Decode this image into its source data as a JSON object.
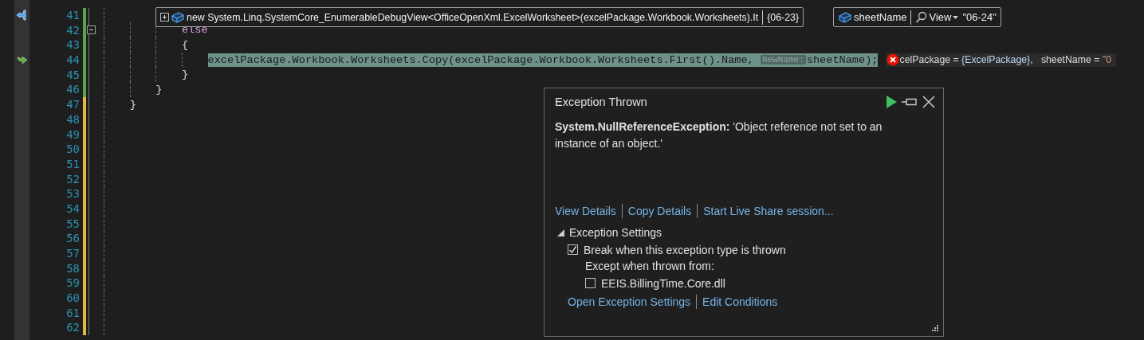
{
  "editor": {
    "lines": [
      {
        "number": "41",
        "color": "#57a64a",
        "marker": {
          "kind": "pin"
        }
      },
      {
        "number": "42",
        "color": "#57a64a",
        "fold": {
          "expanded": true
        },
        "tokens": [
          {
            "text": "            else",
            "kind": "control"
          }
        ]
      },
      {
        "number": "43",
        "color": "#57a64a",
        "tokens": [
          {
            "text": "            {",
            "kind": "plain"
          }
        ]
      },
      {
        "number": "44",
        "color": "#57a64a",
        "marker": {
          "kind": "return"
        },
        "current": true,
        "tokens": [
          {
            "text": "                excelPackage.Workbook.Worksheets.Copy(excelPackage.Workbook.Worksheets.First().Name, ",
            "kind": "plain"
          },
          {
            "text": "NewName:",
            "kind": "hint"
          },
          {
            "text": "sheetName);",
            "kind": "plain"
          }
        ],
        "inline_values": {
          "error": true,
          "parts": [
            {
              "text": "celPackage = ",
              "kind": "plain"
            },
            {
              "text": "{ExcelPackage}",
              "kind": "type"
            },
            {
              "text": ",   sheetName = ",
              "kind": "plain"
            },
            {
              "text": "\"0",
              "kind": "string"
            }
          ]
        }
      },
      {
        "number": "45",
        "color": "#57a64a",
        "tokens": [
          {
            "text": "            }",
            "kind": "plain"
          }
        ]
      },
      {
        "number": "46",
        "color": "#57a64a",
        "tokens": [
          {
            "text": "        }",
            "kind": "plain"
          }
        ]
      },
      {
        "number": "47",
        "color": "#e2b93d",
        "tokens": [
          {
            "text": "    }",
            "kind": "plain"
          }
        ]
      },
      {
        "number": "48",
        "color": "#e2b93d"
      },
      {
        "number": "49",
        "color": "#e2b93d"
      },
      {
        "number": "50",
        "color": "#e2b93d"
      },
      {
        "number": "51",
        "color": "#e2b93d"
      },
      {
        "number": "52",
        "color": "#e2b93d"
      },
      {
        "number": "53",
        "color": "#e2b93d"
      },
      {
        "number": "54",
        "color": "#e2b93d"
      },
      {
        "number": "55",
        "color": "#e2b93d"
      },
      {
        "number": "56",
        "color": "#e2b93d"
      },
      {
        "number": "57",
        "color": "#e2b93d"
      },
      {
        "number": "58",
        "color": "#e2b93d"
      },
      {
        "number": "59",
        "color": "#e2b93d"
      },
      {
        "number": "60",
        "color": "#e2b93d"
      },
      {
        "number": "61",
        "color": "#e2b93d"
      },
      {
        "number": "62",
        "color": "#e2b93d"
      }
    ]
  },
  "datatips": [
    {
      "kind": "expression",
      "expanded": false,
      "expression": "new System.Linq.SystemCore_EnumerableDebugView<OfficeOpenXml.ExcelWorksheet>(excelPackage.Workbook.Worksheets).It",
      "value": "{06-23}"
    },
    {
      "kind": "variable",
      "name": "sheetName",
      "visualizer": "View",
      "value": "\"06-24\""
    }
  ],
  "exception_popup": {
    "title": "Exception Thrown",
    "exception_type": "System.NullReferenceException:",
    "message": "'Object reference not set to an instance of an object.'",
    "links": [
      "View Details",
      "Copy Details",
      "Start Live Share session..."
    ],
    "settings": {
      "title": "Exception Settings",
      "expanded": true,
      "break_when_thrown": {
        "label": "Break when this exception type is thrown",
        "checked": true
      },
      "except_label": "Except when thrown from:",
      "modules": [
        {
          "label": "EEIS.BillingTime.Core.dll",
          "checked": false
        }
      ]
    },
    "footer_links": [
      "Open Exception Settings",
      "Edit Conditions"
    ]
  }
}
